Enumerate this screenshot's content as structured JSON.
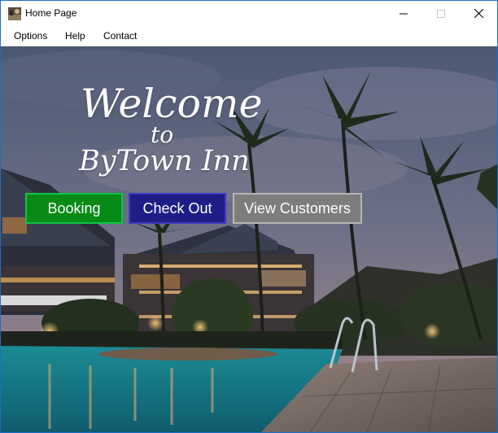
{
  "window": {
    "title": "Home Page"
  },
  "menu": {
    "items": [
      "Options",
      "Help",
      "Contact"
    ]
  },
  "hero": {
    "line1": "Welcome",
    "line2": "to",
    "line3": "ByTown Inn"
  },
  "buttons": {
    "booking": "Booking",
    "checkout": "Check Out",
    "view_customers": "View Customers"
  },
  "colors": {
    "booking": "#078a16",
    "checkout": "#1d1f86",
    "view_customers": "#7d7d7d",
    "window_border": "#1a6fc9"
  },
  "icons": {
    "app": "hotel-photo-icon",
    "minimize": "minimize-icon",
    "maximize": "maximize-icon",
    "close": "close-icon"
  }
}
